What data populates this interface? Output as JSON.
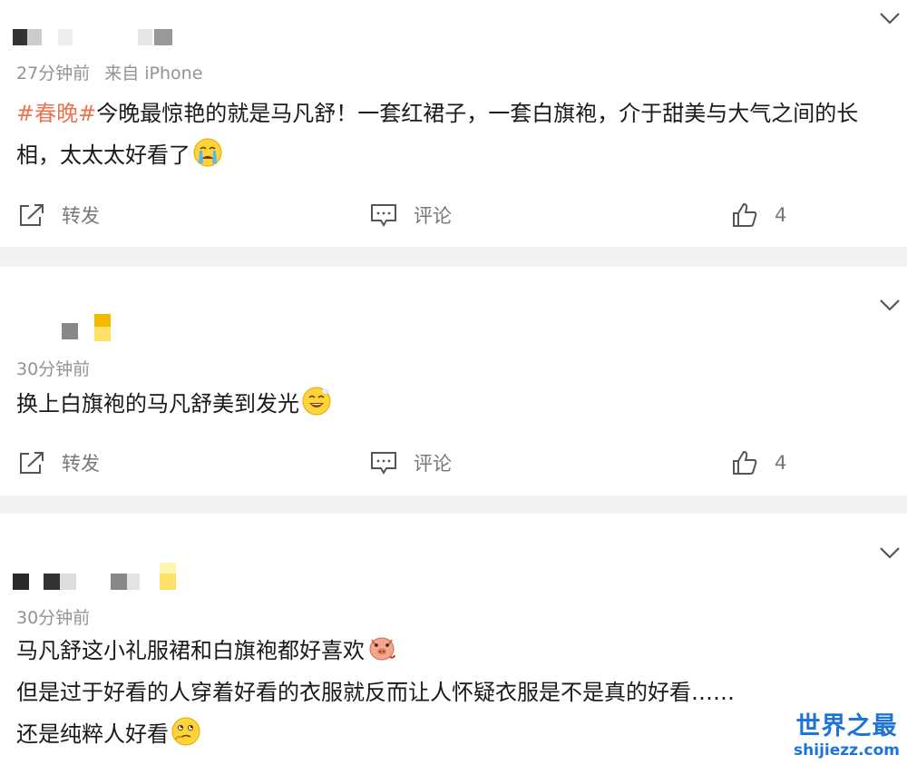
{
  "comments": [
    {
      "time": "27分钟前",
      "source": "来自 iPhone",
      "topic": "#春晚#",
      "text": "今晚最惊艳的就是马凡舒！一套红裙子，一套白旗袍，介于甜美与大气之间的长",
      "text2": "相，太太太好看了",
      "emoji": "crying-face",
      "repost_label": "转发",
      "comment_label": "评论",
      "like_count": "4"
    },
    {
      "time": "30分钟前",
      "text": "换上白旗袍的马凡舒美到发光",
      "emoji": "grinning-face",
      "repost_label": "转发",
      "comment_label": "评论",
      "like_count": "4"
    },
    {
      "time": "30分钟前",
      "line1": "马凡舒这小礼服裙和白旗袍都好喜欢",
      "line2": "但是过于好看的人穿着好看的衣服就反而让人怀疑衣服是不是真的好看……",
      "line3": "还是纯粹人好看",
      "emoji1": "pig-face",
      "emoji2": "thinking-face"
    }
  ],
  "watermark": {
    "title": "世界之最",
    "url": "shijiezz.com"
  },
  "colors": {
    "topic": "#eb7350",
    "separator": "#f2f2f2",
    "meta": "#939393",
    "watermark": "#1e74d6"
  }
}
